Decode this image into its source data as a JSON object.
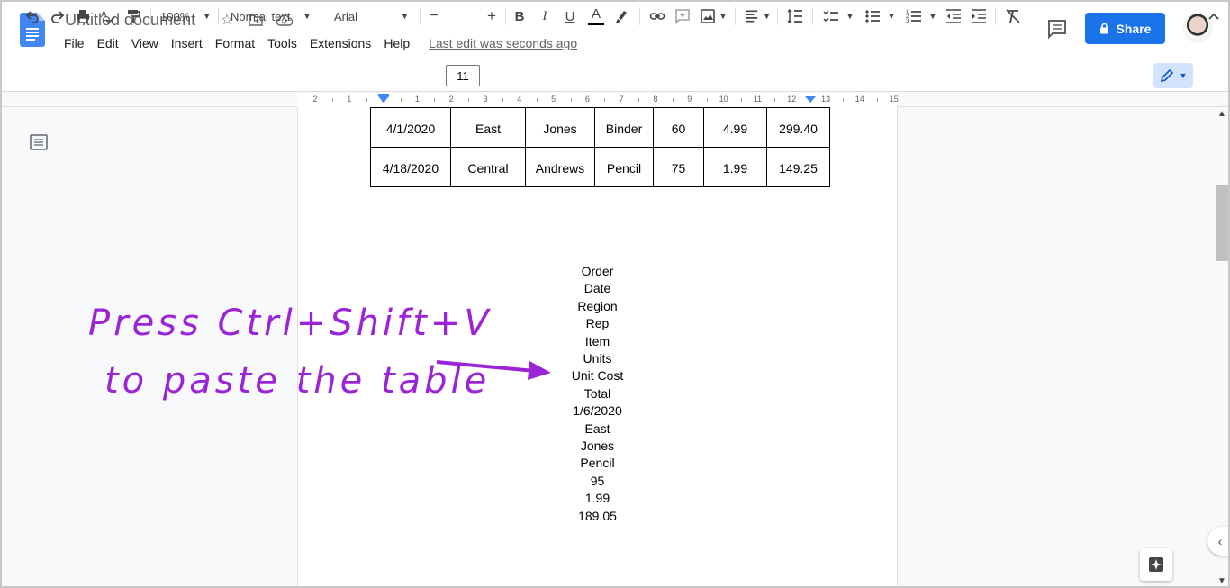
{
  "header": {
    "title": "Untitled document",
    "icons": [
      "star-icon",
      "move-to-folder-icon",
      "cloud-saved-icon"
    ],
    "menu": [
      "File",
      "Edit",
      "View",
      "Insert",
      "Format",
      "Tools",
      "Extensions",
      "Help"
    ],
    "last_edit": "Last edit was seconds ago",
    "share_label": "Share"
  },
  "toolbar": {
    "zoom": "100%",
    "style": "Normal text",
    "font": "Arial",
    "font_size": "11",
    "minus": "−",
    "plus": "+"
  },
  "ruler": {
    "numbers": [
      "2",
      "1",
      "1",
      "1",
      "2",
      "3",
      "4",
      "5",
      "6",
      "7",
      "8",
      "9",
      "10",
      "11",
      "12",
      "13",
      "14",
      "15"
    ]
  },
  "table": {
    "rows": [
      [
        "4/1/2020",
        "East",
        "Jones",
        "Binder",
        "60",
        "4.99",
        "299.40"
      ],
      [
        "4/18/2020",
        "Central",
        "Andrews",
        "Pencil",
        "75",
        "1.99",
        "149.25"
      ]
    ]
  },
  "pasted_lines": [
    "Order",
    "Date",
    "Region",
    "Rep",
    "Item",
    "Units",
    "Unit Cost",
    "Total",
    "1/6/2020",
    "East",
    "Jones",
    "Pencil",
    "95",
    "1.99",
    "189.05"
  ],
  "annotation": {
    "line1": "Press Ctrl+Shift+V",
    "line2": "to paste the table",
    "color": "#9b25d6"
  },
  "colors": {
    "share": "#1a73e8",
    "doc_blue": "#4285f4"
  }
}
